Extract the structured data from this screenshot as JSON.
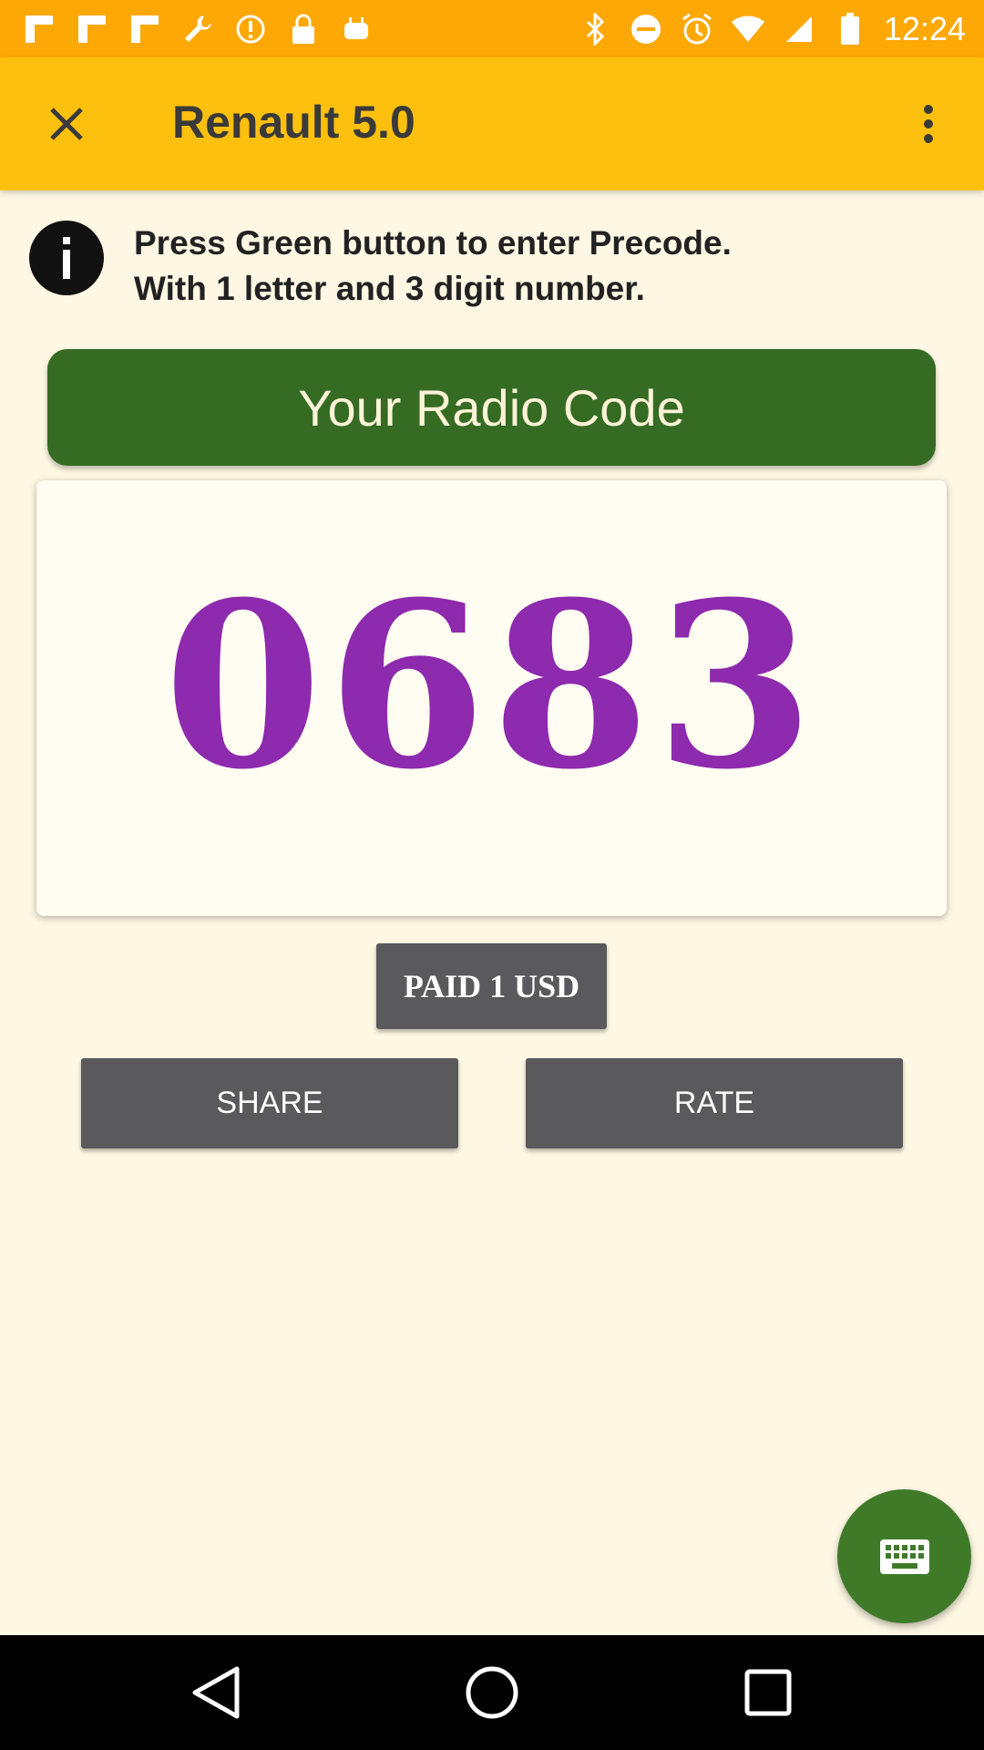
{
  "status_bar": {
    "time": "12:24",
    "left_icons": [
      "flipboard-icon",
      "flipboard-icon",
      "flipboard-icon",
      "wrench-icon",
      "alert-icon",
      "lock-icon",
      "android-icon"
    ],
    "right_icons": [
      "bluetooth-icon",
      "do-not-disturb-icon",
      "alarm-icon",
      "wifi-icon",
      "signal-icon",
      "battery-icon"
    ]
  },
  "app_bar": {
    "title": "Renault 5.0",
    "close_icon": "close-icon",
    "menu_icon": "more-vert-icon"
  },
  "info": {
    "icon": "info-icon",
    "line1": "Press Green button to enter Precode.",
    "line2": "With 1 letter and 3 digit number."
  },
  "radio_code": {
    "header": "Your Radio Code",
    "code": "0683"
  },
  "buttons": {
    "paid": "PAID 1 USD",
    "share": "SHARE",
    "rate": "RATE"
  },
  "fab": {
    "icon": "keyboard-icon"
  },
  "navigation": {
    "back_icon": "back-icon",
    "home_icon": "home-icon",
    "recent_icon": "recent-apps-icon"
  },
  "colors": {
    "status_bar": "#fea806",
    "app_bar": "#fec00e",
    "background": "#fdf7e3",
    "green": "#356b23",
    "code": "#8e2aad",
    "button": "#5a5a5c"
  }
}
